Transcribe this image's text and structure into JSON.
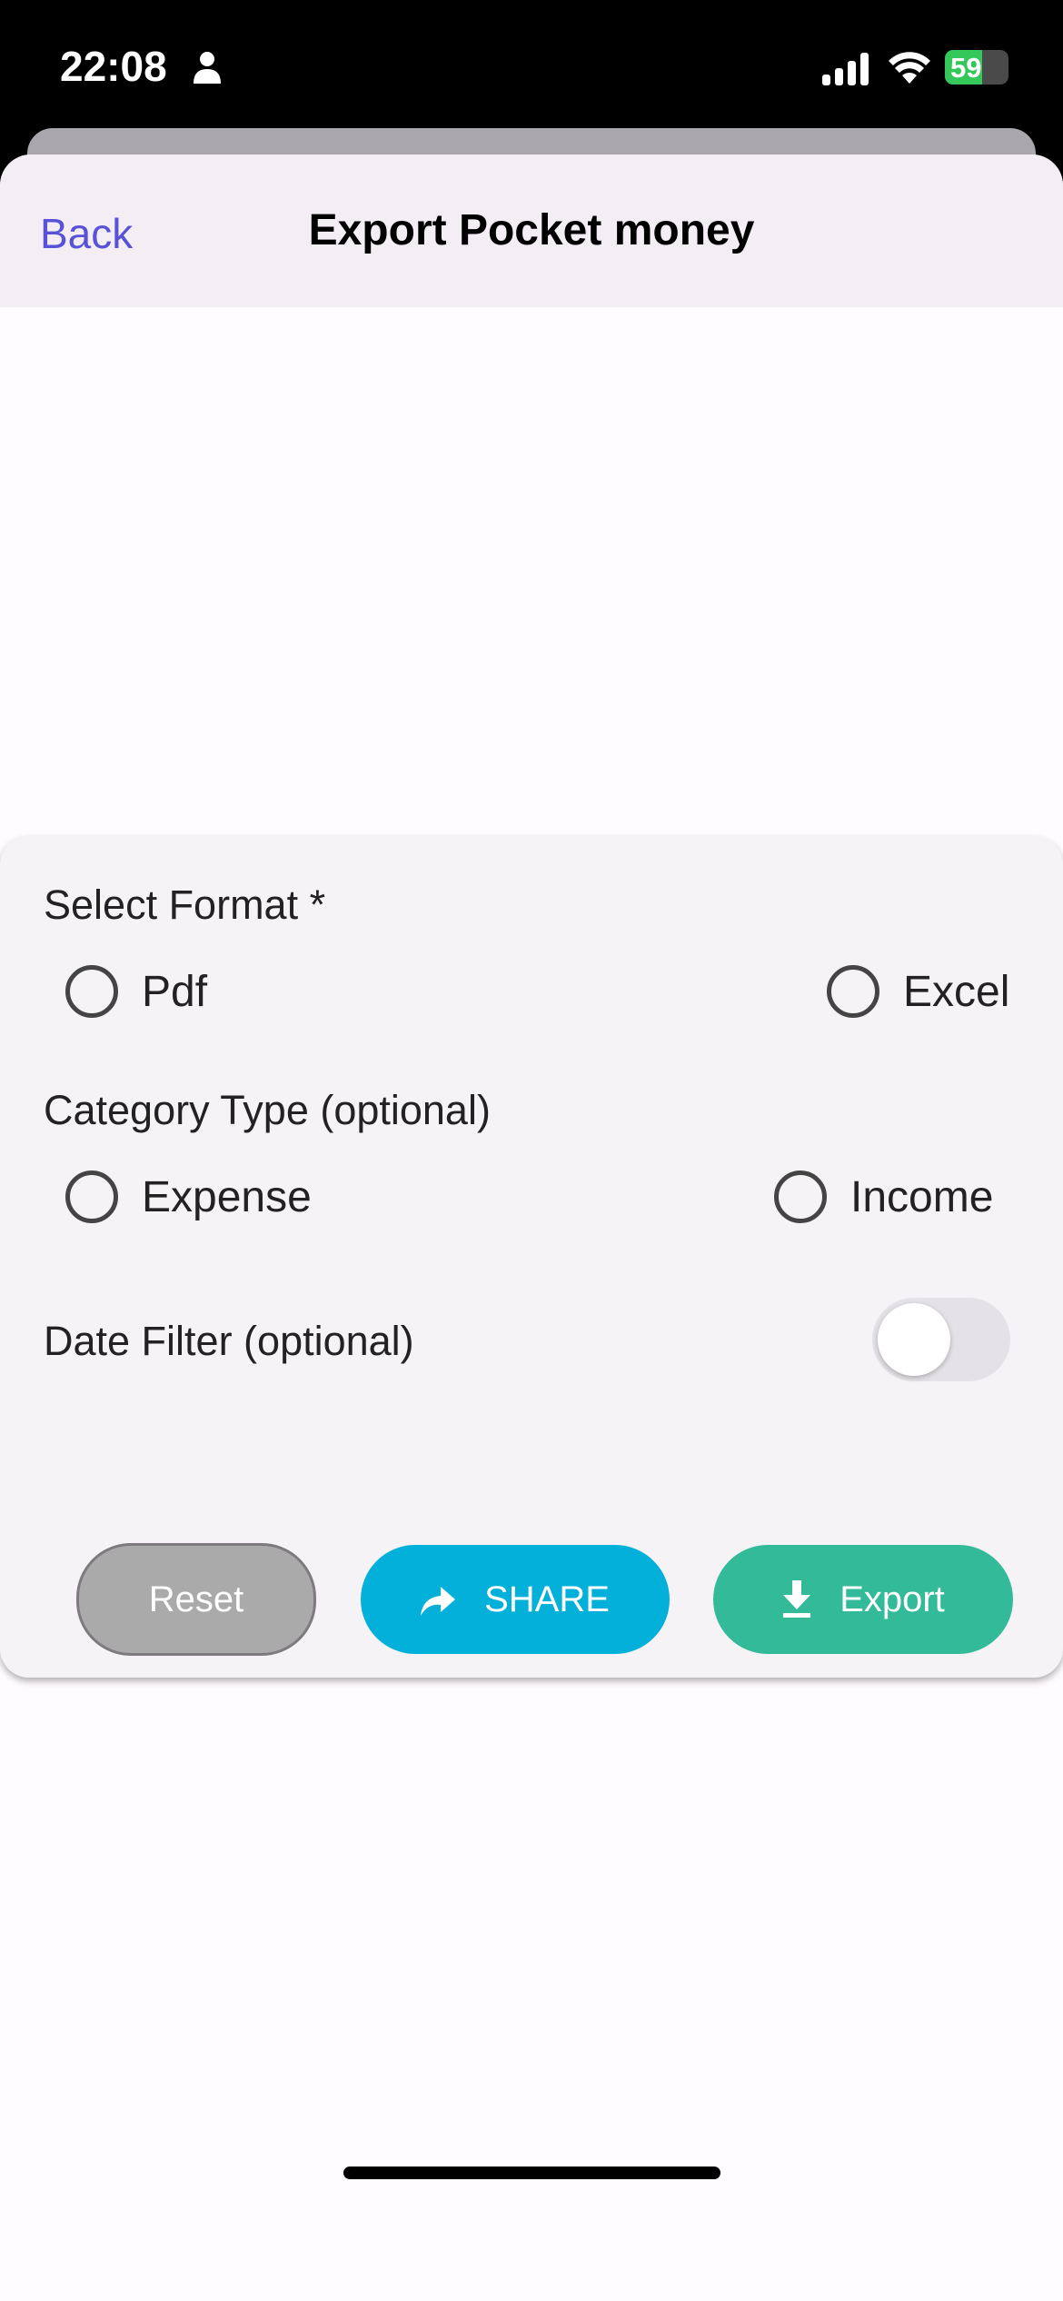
{
  "status_bar": {
    "time": "22:08",
    "battery": "59",
    "battery_percent": 59
  },
  "header": {
    "back_label": "Back",
    "title": "Export Pocket money"
  },
  "form": {
    "format_label": "Select Format *",
    "format_options": [
      "Pdf",
      "Excel"
    ],
    "category_label": "Category Type (optional)",
    "category_options": [
      "Expense",
      "Income"
    ],
    "date_filter_label": "Date Filter (optional)",
    "date_filter_on": false
  },
  "buttons": {
    "reset": "Reset",
    "share": "SHARE",
    "export": "Export"
  },
  "colors": {
    "accent": "#5a52d6",
    "share": "#02b0da",
    "export": "#33ba98",
    "reset": "#aaaaaa"
  }
}
